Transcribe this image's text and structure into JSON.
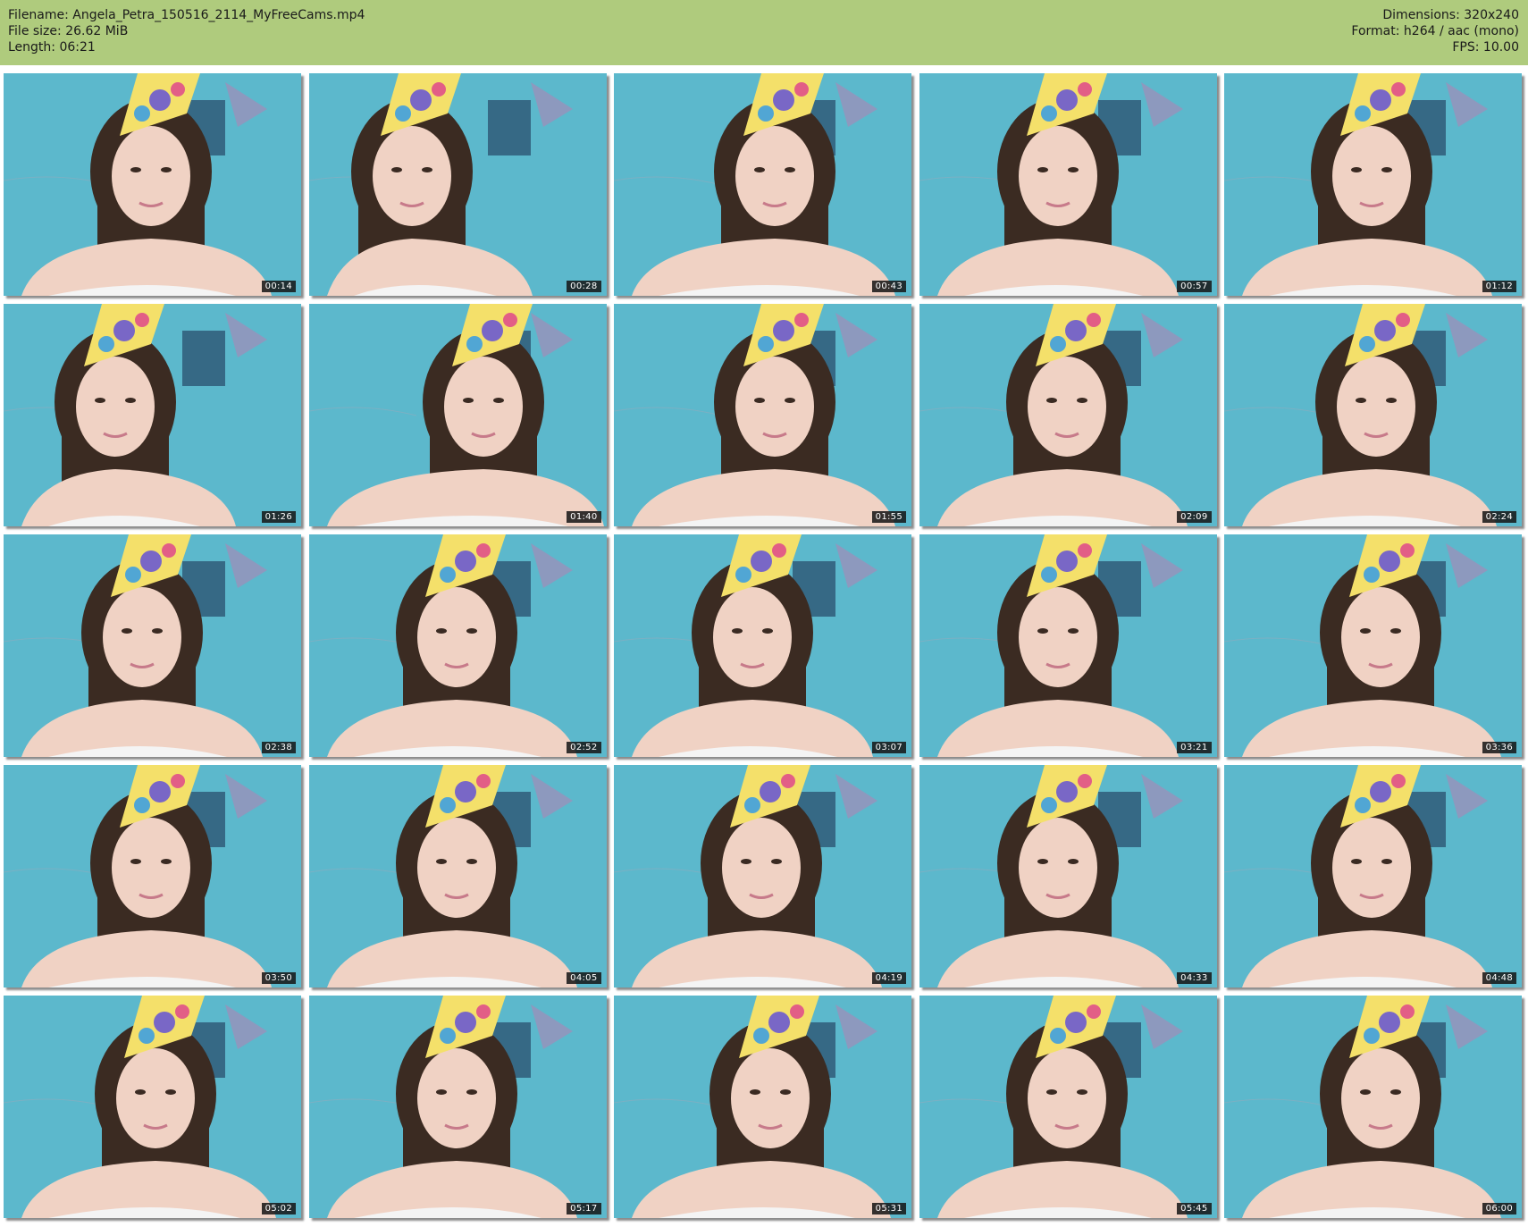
{
  "header": {
    "filename_label": "Filename: Angela_Petra_150516_2114_MyFreeCams.mp4",
    "filesize_label": "File size: 26.62 MiB",
    "length_label": "Length: 06:21",
    "dimensions_label": "Dimensions: 320x240",
    "format_label": "Format: h264 / aac (mono)",
    "fps_label": "FPS: 10.00"
  },
  "colors": {
    "header_bg": "#afcb7d",
    "wall": "#5cb8cc",
    "hair": "#3b2b22",
    "skin": "#f0d2c4"
  },
  "thumbnails": [
    {
      "time": "00:14"
    },
    {
      "time": "00:28"
    },
    {
      "time": "00:43"
    },
    {
      "time": "00:57"
    },
    {
      "time": "01:12"
    },
    {
      "time": "01:26"
    },
    {
      "time": "01:40"
    },
    {
      "time": "01:55"
    },
    {
      "time": "02:09"
    },
    {
      "time": "02:24"
    },
    {
      "time": "02:38"
    },
    {
      "time": "02:52"
    },
    {
      "time": "03:07"
    },
    {
      "time": "03:21"
    },
    {
      "time": "03:36"
    },
    {
      "time": "03:50"
    },
    {
      "time": "04:05"
    },
    {
      "time": "04:19"
    },
    {
      "time": "04:33"
    },
    {
      "time": "04:48"
    },
    {
      "time": "05:02"
    },
    {
      "time": "05:17"
    },
    {
      "time": "05:31"
    },
    {
      "time": "05:45"
    },
    {
      "time": "06:00"
    }
  ]
}
